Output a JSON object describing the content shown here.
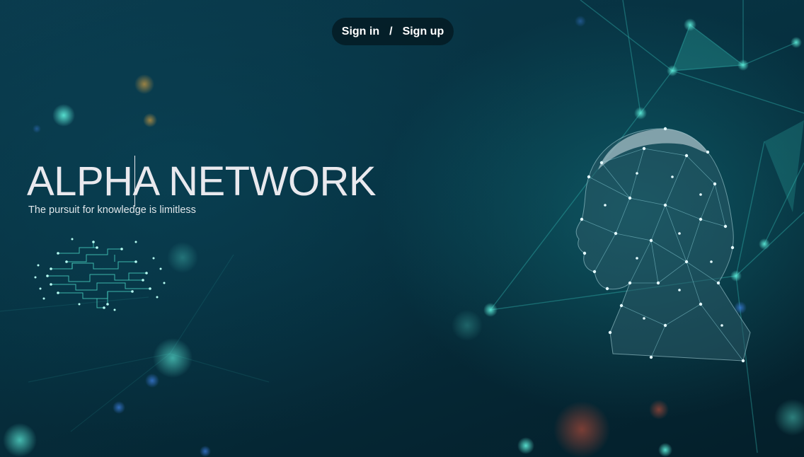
{
  "auth": {
    "sign_in_label": "Sign in",
    "separator": "/",
    "sign_up_label": "Sign up"
  },
  "hero": {
    "title": "ALPHA NETWORK",
    "subtitle": "The pursuit for knowledge is limitless"
  },
  "icons": {
    "brain": "circuit-brain-icon",
    "head": "wireframe-head-illustration"
  },
  "colors": {
    "background": "#06303f",
    "accent": "#3fd4c4",
    "title": "#e9e9ee",
    "pill": "#041820"
  }
}
